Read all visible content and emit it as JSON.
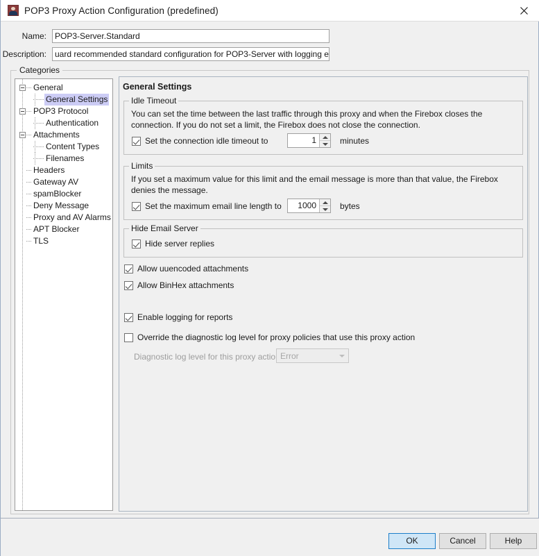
{
  "window": {
    "title": "POP3 Proxy Action Configuration (predefined)",
    "icon": "proxy-action-icon",
    "close_icon": "close-icon"
  },
  "header": {
    "name_label": "Name:",
    "name_value": "POP3-Server.Standard",
    "description_label": "Description:",
    "description_value": "uard recommended standard configuration for POP3-Server with logging enabled"
  },
  "categories": {
    "legend": "Categories",
    "tree": [
      {
        "label": "General",
        "level": 0,
        "expander": true,
        "selected": false
      },
      {
        "label": "General Settings",
        "level": 1,
        "expander": false,
        "selected": true
      },
      {
        "label": "POP3 Protocol",
        "level": 0,
        "expander": true,
        "selected": false
      },
      {
        "label": "Authentication",
        "level": 1,
        "expander": false,
        "selected": false
      },
      {
        "label": "Attachments",
        "level": 0,
        "expander": true,
        "selected": false
      },
      {
        "label": "Content Types",
        "level": 1,
        "expander": false,
        "selected": false
      },
      {
        "label": "Filenames",
        "level": 1,
        "expander": false,
        "selected": false
      },
      {
        "label": "Headers",
        "level": 0,
        "expander": false,
        "selected": false
      },
      {
        "label": "Gateway AV",
        "level": 0,
        "expander": false,
        "selected": false
      },
      {
        "label": "spamBlocker",
        "level": 0,
        "expander": false,
        "selected": false
      },
      {
        "label": "Deny Message",
        "level": 0,
        "expander": false,
        "selected": false
      },
      {
        "label": "Proxy and AV Alarms",
        "level": 0,
        "expander": false,
        "selected": false
      },
      {
        "label": "APT Blocker",
        "level": 0,
        "expander": false,
        "selected": false
      },
      {
        "label": "TLS",
        "level": 0,
        "expander": false,
        "selected": false
      }
    ]
  },
  "panel": {
    "title": "General Settings",
    "idle_timeout": {
      "legend": "Idle Timeout",
      "description": "You can set the time between the last traffic through this proxy and when the Firebox closes the connection. If you do not set a limit, the Firebox does not close the connection.",
      "checkbox_label": "Set the connection idle timeout to",
      "checked": true,
      "value": "1",
      "unit": "minutes"
    },
    "limits": {
      "legend": "Limits",
      "description": "If you set a maximum value for this limit and the email message is more than that value, the Firebox denies the message.",
      "checkbox_label": "Set the maximum email line length to",
      "checked": true,
      "value": "1000",
      "unit": "bytes"
    },
    "hide_email_server": {
      "legend": "Hide Email Server",
      "checkbox_label": "Hide server replies",
      "checked": true
    },
    "options": [
      {
        "label": "Allow uuencoded attachments",
        "checked": true
      },
      {
        "label": "Allow BinHex attachments",
        "checked": true
      },
      {
        "label": "Enable logging for reports",
        "checked": true
      },
      {
        "label": "Override the diagnostic log level for proxy policies that use this proxy action",
        "checked": false
      }
    ],
    "diagnostic": {
      "label": "Diagnostic log level for this proxy action",
      "value": "Error",
      "enabled": false
    }
  },
  "footer": {
    "ok_label": "OK",
    "cancel_label": "Cancel",
    "help_label": "Help"
  },
  "colors": {
    "dialog_bg": "#f0f0f0",
    "selection": "#ccccf5",
    "accent": "#1c7ec9"
  }
}
